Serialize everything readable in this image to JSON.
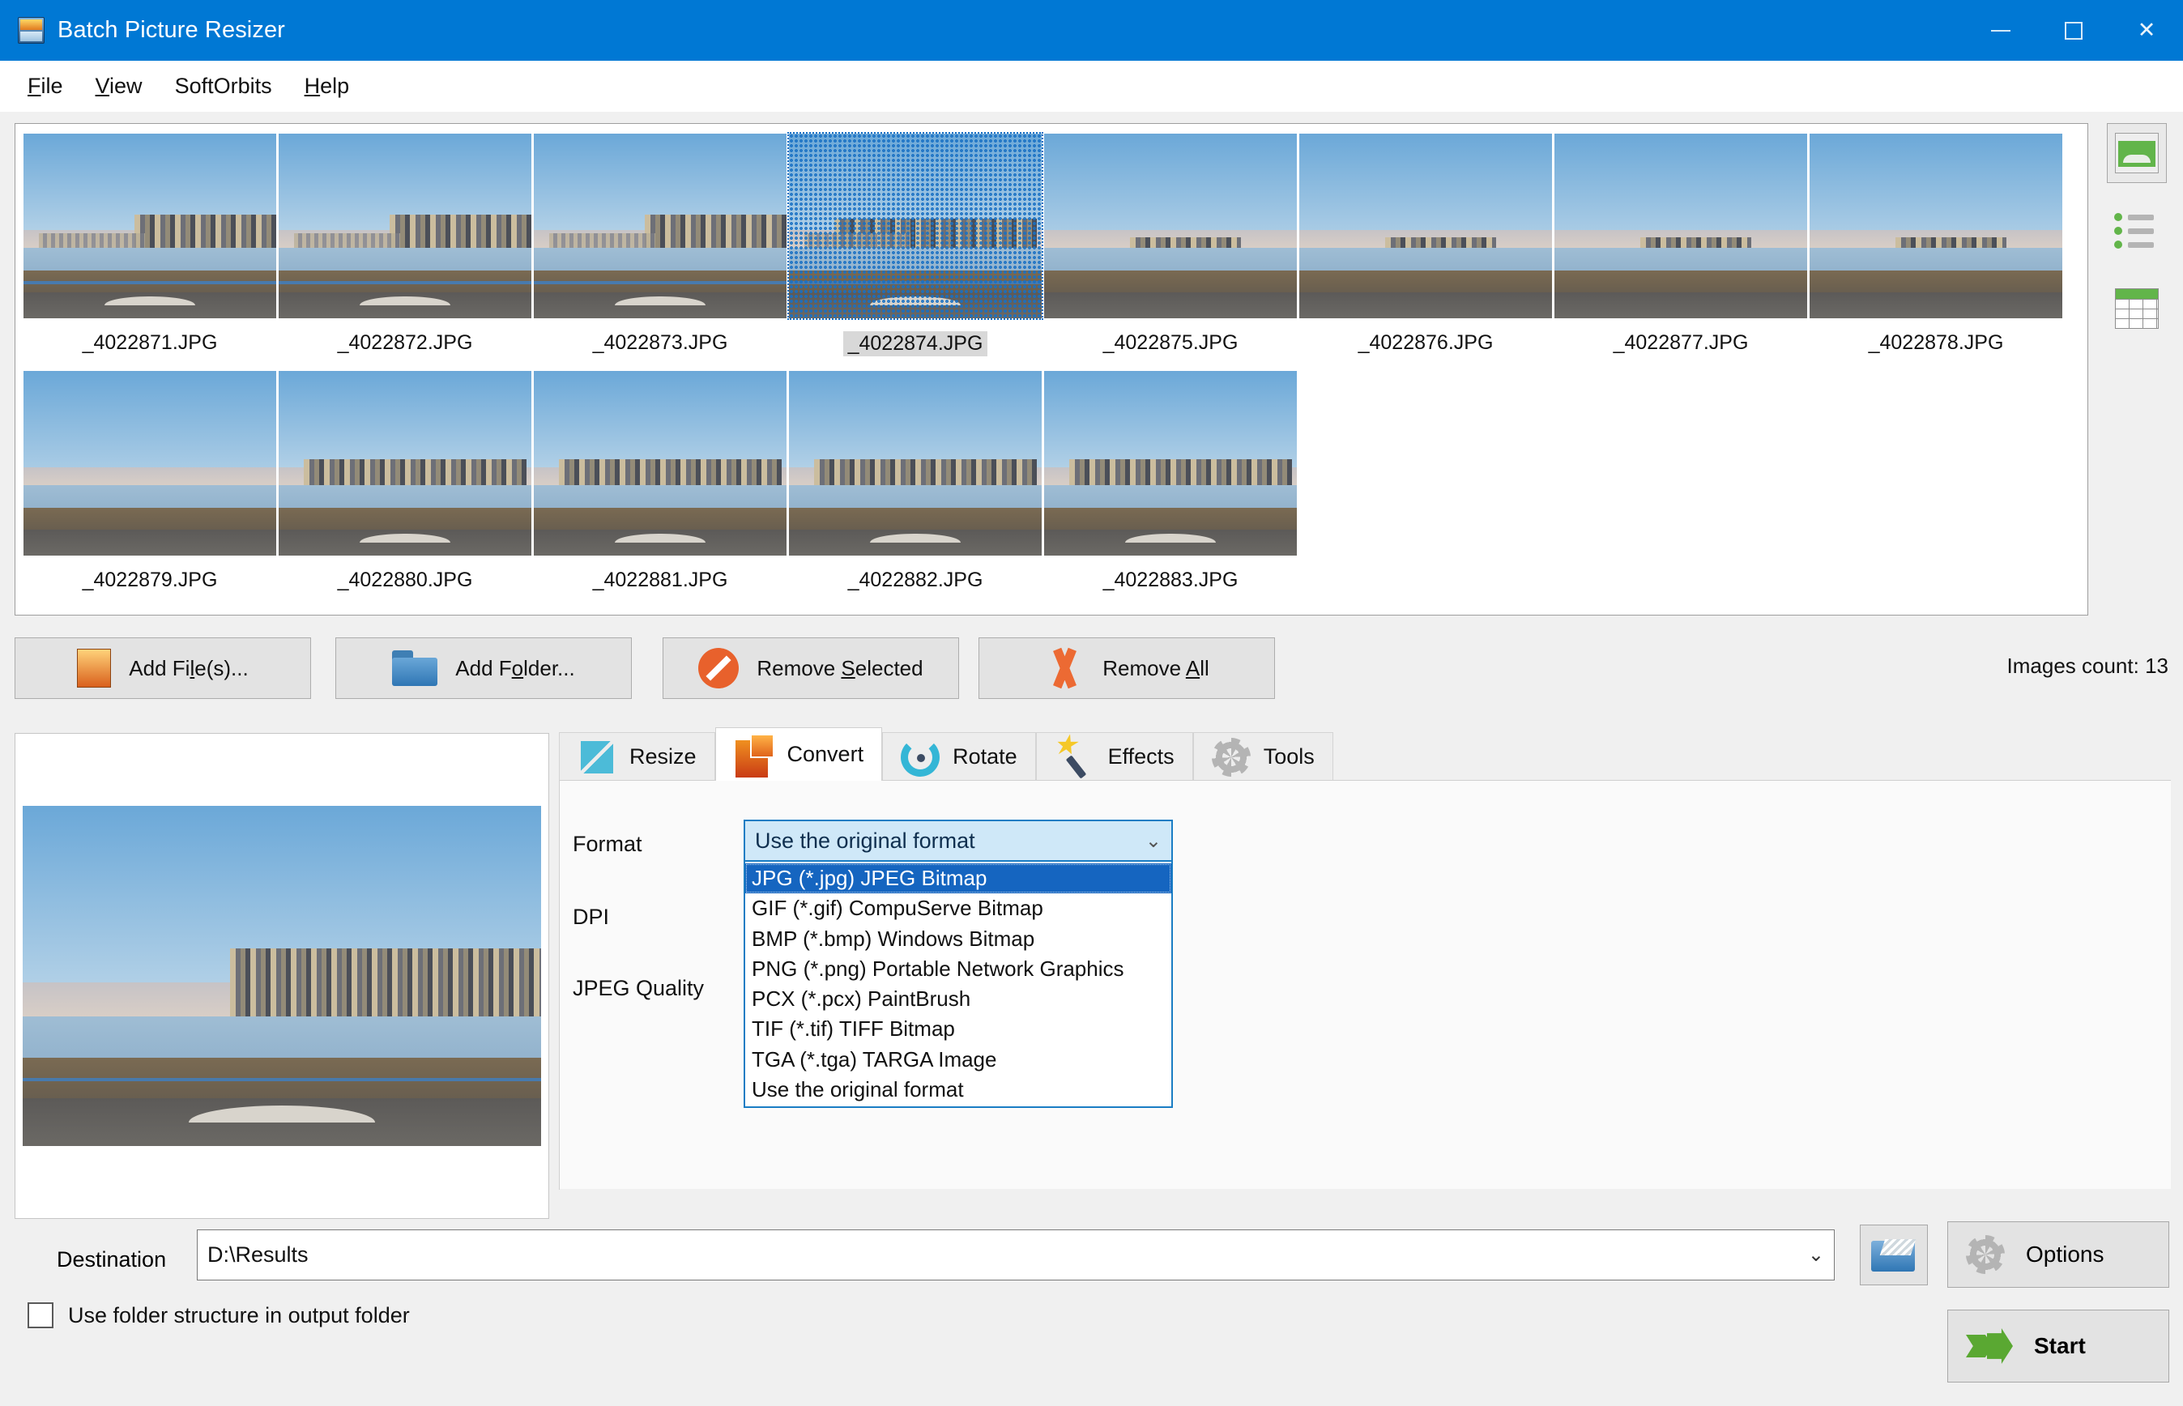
{
  "window": {
    "title": "Batch Picture Resizer",
    "app_icon": "picture-app-icon",
    "minimize": "−",
    "maximize": "□",
    "close": "✕",
    "titlebar_color": "#0078d4"
  },
  "menubar": {
    "items": [
      {
        "label": "File",
        "accel": "F"
      },
      {
        "label": "View",
        "accel": "V"
      },
      {
        "label": "SoftOrbits",
        "accel": ""
      },
      {
        "label": "Help",
        "accel": "H"
      }
    ]
  },
  "thumbnails": {
    "selected": "_4022874.JPG",
    "row1": [
      {
        "name": "_4022871.JPG",
        "variant": "a"
      },
      {
        "name": "_4022872.JPG",
        "variant": "a"
      },
      {
        "name": "_4022873.JPG",
        "variant": "a"
      },
      {
        "name": "_4022874.JPG",
        "variant": "b"
      },
      {
        "name": "_4022875.JPG",
        "variant": "far"
      },
      {
        "name": "_4022876.JPG",
        "variant": "far"
      },
      {
        "name": "_4022877.JPG",
        "variant": "far"
      },
      {
        "name": "_4022878.JPG",
        "variant": "far"
      }
    ],
    "row2": [
      {
        "name": "_4022879.JPG",
        "variant": "far"
      },
      {
        "name": "_4022880.JPG",
        "variant": "c"
      },
      {
        "name": "_4022881.JPG",
        "variant": "c"
      },
      {
        "name": "_4022882.JPG",
        "variant": "c"
      },
      {
        "name": "_4022883.JPG",
        "variant": "c"
      }
    ]
  },
  "view_modes": [
    {
      "name": "thumbnail-view",
      "active": true
    },
    {
      "name": "list-view",
      "active": false
    },
    {
      "name": "details-view",
      "active": false
    }
  ],
  "actions": {
    "add_files": {
      "pre": "Add Fi",
      "accel": "l",
      "post": "e(s)..."
    },
    "add_folder": {
      "pre": "Add F",
      "accel": "o",
      "post": "lder..."
    },
    "remove_selected": {
      "pre": "Remove ",
      "accel": "S",
      "post": "elected"
    },
    "remove_all": {
      "pre": "Remove ",
      "accel": "A",
      "post": "ll"
    },
    "images_count": "Images count: 13"
  },
  "tabs": [
    {
      "label": "Resize",
      "icon": "resize-icon",
      "active": false
    },
    {
      "label": "Convert",
      "icon": "convert-icon",
      "active": true
    },
    {
      "label": "Rotate",
      "icon": "rotate-icon",
      "active": false
    },
    {
      "label": "Effects",
      "icon": "effects-icon",
      "active": false
    },
    {
      "label": "Tools",
      "icon": "gear-icon",
      "active": false
    }
  ],
  "convert": {
    "format_label": "Format",
    "dpi_label": "DPI",
    "jpeg_quality_label": "JPEG Quality",
    "format_value": "Use the original format",
    "dropdown_open": true,
    "dropdown_highlight_color": "#1565c0",
    "format_options": [
      "JPG (*.jpg) JPEG Bitmap",
      "GIF (*.gif) CompuServe Bitmap",
      "BMP (*.bmp) Windows Bitmap",
      "PNG (*.png) Portable Network Graphics",
      "PCX (*.pcx) PaintBrush",
      "TIF (*.tif) TIFF Bitmap",
      "TGA (*.tga) TARGA Image",
      "Use the original format"
    ],
    "selected_option_index": 0
  },
  "footer": {
    "destination_label": "Destination",
    "destination_value": "D:\\Results",
    "browse_icon": "browse-folder-icon",
    "options_label": "Options",
    "start_label": "Start",
    "use_folder_structure_label": "Use folder structure in output folder",
    "use_folder_structure_checked": false
  }
}
